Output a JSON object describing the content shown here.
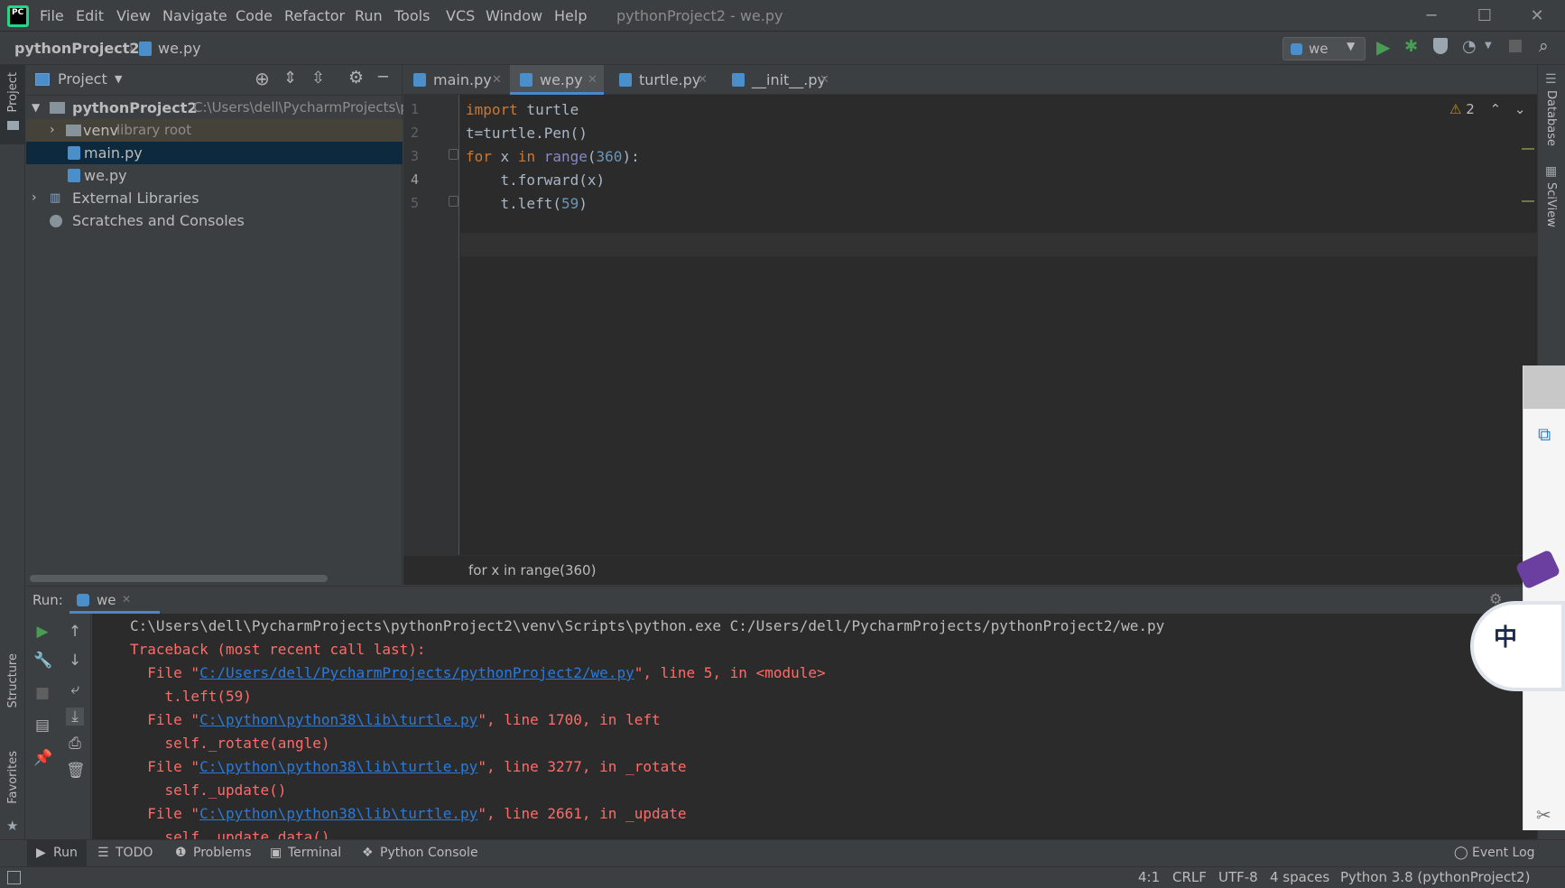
{
  "window": {
    "title": "pythonProject2 - we.py",
    "app_icon": "pycharm-logo-icon",
    "menu": [
      "File",
      "Edit",
      "View",
      "Navigate",
      "Code",
      "Refactor",
      "Run",
      "Tools",
      "VCS",
      "Window",
      "Help"
    ]
  },
  "navbar": {
    "project": "pythonProject2",
    "file": "we.py",
    "run_config": "we"
  },
  "left_stripe": {
    "project": "Project",
    "structure": "Structure",
    "favorites": "Favorites"
  },
  "right_stripe": {
    "database": "Database",
    "sciview": "SciView"
  },
  "project_panel": {
    "title": "Project",
    "tree": [
      {
        "label": "pythonProject2",
        "hint": "C:\\Users\\dell\\PycharmProjects\\py"
      },
      {
        "label": "venv",
        "hint": "library root"
      },
      {
        "label": "main.py"
      },
      {
        "label": "we.py"
      },
      {
        "label": "External Libraries"
      },
      {
        "label": "Scratches and Consoles"
      }
    ]
  },
  "editor": {
    "tabs": [
      {
        "label": "main.py"
      },
      {
        "label": "we.py"
      },
      {
        "label": "turtle.py"
      },
      {
        "label": "__init__.py"
      }
    ],
    "line_numbers": [
      "1",
      "2",
      "3",
      "4",
      "5"
    ],
    "code": {
      "l1_kw": "import",
      "l1_rest": " turtle",
      "l2": "t=turtle.Pen()",
      "l3_kw": "for",
      "l3_a": " x ",
      "l3_in": "in",
      "l3_sp": " ",
      "l3_fn": "range",
      "l3_b": "(",
      "l3_num": "360",
      "l3_c": "):",
      "l4": "    t.forward(x)",
      "l5_a": "    t.left(",
      "l5_num": "59",
      "l5_b": ")"
    },
    "warnings_count": "2",
    "breadcrumb": "for x in range(360)"
  },
  "run_panel": {
    "label": "Run:",
    "tab": "we",
    "console": {
      "cmd": "C:\\Users\\dell\\PycharmProjects\\pythonProject2\\venv\\Scripts\\python.exe C:/Users/dell/PycharmProjects/pythonProject2/we.py",
      "traceback": "Traceback (most recent call last):",
      "f1_pre": "  File \"",
      "f1_link": "C:/Users/dell/PycharmProjects/pythonProject2/we.py",
      "f1_post": "\", line 5, in <module>",
      "f1_code": "    t.left(59)",
      "f2_pre": "  File \"",
      "f2_link": "C:\\python\\python38\\lib\\turtle.py",
      "f2_post": "\", line 1700, in left",
      "f2_code": "    self._rotate(angle)",
      "f3_pre": "  File \"",
      "f3_link": "C:\\python\\python38\\lib\\turtle.py",
      "f3_post": "\", line 3277, in _rotate",
      "f3_code": "    self._update()",
      "f4_pre": "  File \"",
      "f4_link": "C:\\python\\python38\\lib\\turtle.py",
      "f4_post": "\", line 2661, in _update",
      "f4_code": "    self._update_data()"
    }
  },
  "tool_windows": [
    "Run",
    "TODO",
    "Problems",
    "Terminal",
    "Python Console",
    "Event Log"
  ],
  "status": {
    "position": "4:1",
    "line_sep": "CRLF",
    "encoding": "UTF-8",
    "indent": "4 spaces",
    "interpreter": "Python 3.8 (pythonProject2)"
  },
  "overlay_text": "中",
  "colors": {
    "bg": "#3c3f41",
    "editor_bg": "#2b2b2b",
    "keyword": "#cc7832",
    "number": "#6897bb",
    "builtin": "#8888c6",
    "error": "#ff6b68",
    "link": "#287bde",
    "run_green": "#499c54"
  }
}
